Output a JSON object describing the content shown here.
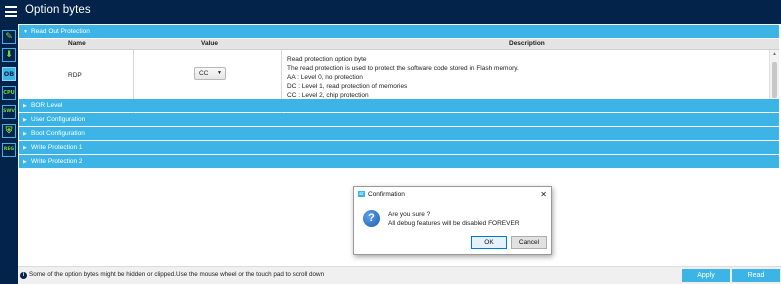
{
  "app": {
    "title": "Option bytes"
  },
  "leftbar": {
    "icons": [
      {
        "name": "edit-icon",
        "glyph": "✎"
      },
      {
        "name": "download-icon",
        "glyph": "⬇"
      },
      {
        "name": "ob-icon",
        "glyph": "OB"
      },
      {
        "name": "cpu-icon",
        "glyph": "CPU"
      },
      {
        "name": "swv-icon",
        "glyph": "SWV"
      },
      {
        "name": "shield-icon",
        "glyph": "⛨"
      },
      {
        "name": "reg-icon",
        "glyph": "REG"
      }
    ]
  },
  "sections": {
    "read_out_protection": "Read Out Protection",
    "bor_level": "BOR Level",
    "user_configuration": "User Configuration",
    "boot_configuration": "Boot Configuration",
    "write_protection_1": "Write Protection 1",
    "write_protection_2": "Write Protection 2"
  },
  "table": {
    "headers": {
      "name": "Name",
      "value": "Value",
      "description": "Description"
    },
    "rows": [
      {
        "name": "RDP",
        "value": "CC",
        "description": [
          "Read protection option byte",
          "The read protection is used to protect the software code stored in Flash memory.",
          "AA : Level 0, no protection",
          "DC : Level 1, read protection of memories",
          "CC : Level 2, chip protection"
        ]
      }
    ]
  },
  "footer": {
    "info_text": "Some of the option bytes might be hidden or clipped.Use the mouse wheel or the touch pad to scroll down",
    "apply_label": "Apply",
    "read_label": "Read"
  },
  "dialog": {
    "title": "Confirmation",
    "message_line1": "Are you sure ?",
    "message_line2": "All debug features will be disabled FOREVER",
    "ok_label": "OK",
    "cancel_label": "Cancel",
    "close_glyph": "✕",
    "app_icon_text": "ST"
  },
  "colors": {
    "navy": "#03234b",
    "accent": "#3cb4e6"
  }
}
